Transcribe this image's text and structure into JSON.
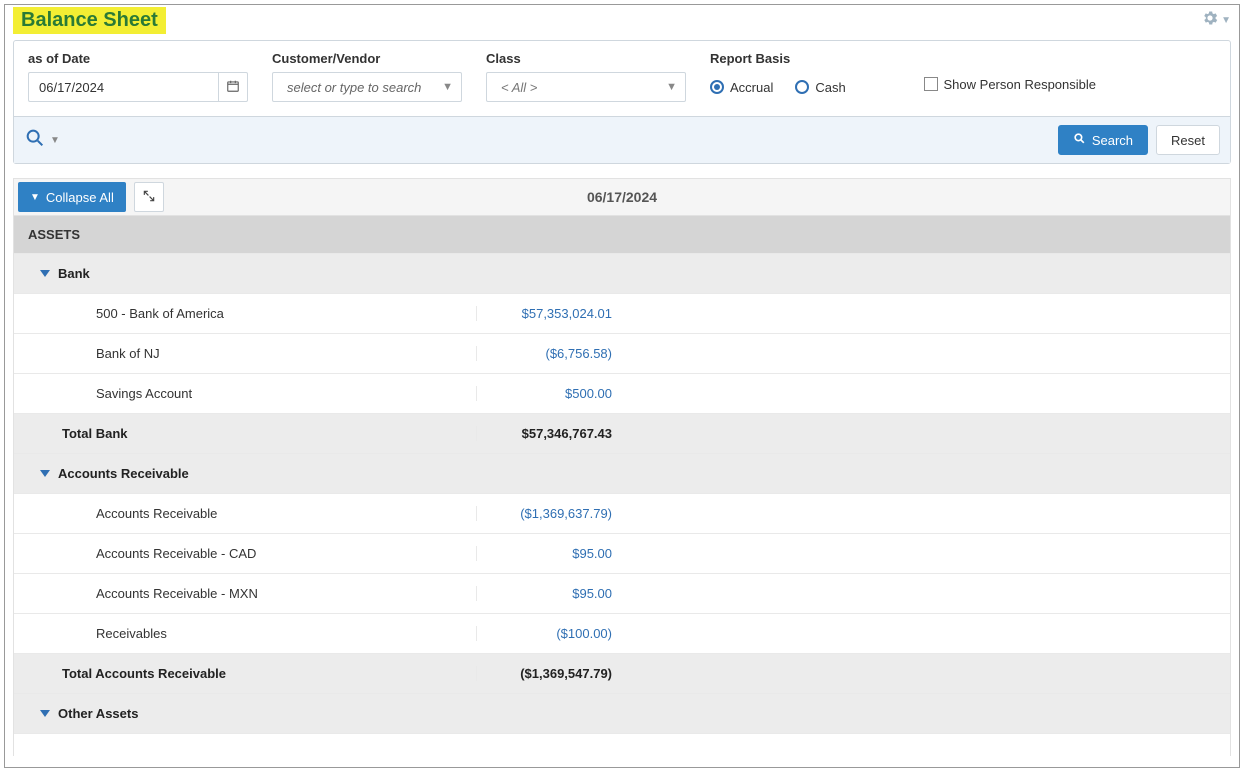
{
  "page": {
    "title": "Balance Sheet"
  },
  "filters": {
    "date_label": "as of Date",
    "date_value": "06/17/2024",
    "cv_label": "Customer/Vendor",
    "cv_placeholder": "select or type to search",
    "class_label": "Class",
    "class_value": "< All >",
    "basis_label": "Report Basis",
    "basis_accrual": "Accrual",
    "basis_cash": "Cash",
    "show_person_label": "Show Person Responsible"
  },
  "buttons": {
    "search": "Search",
    "reset": "Reset",
    "collapse_all": "Collapse All"
  },
  "toolbar": {
    "date": "06/17/2024"
  },
  "grid": {
    "assets_header": "ASSETS",
    "groups": [
      {
        "name": "Bank",
        "rows": [
          {
            "label": "500 - Bank of America",
            "value": "$57,353,024.01"
          },
          {
            "label": "Bank of NJ",
            "value": "($6,756.58)"
          },
          {
            "label": "Savings Account",
            "value": "$500.00"
          }
        ],
        "total_label": "Total Bank",
        "total_value": "$57,346,767.43"
      },
      {
        "name": "Accounts Receivable",
        "rows": [
          {
            "label": "Accounts Receivable",
            "value": "($1,369,637.79)"
          },
          {
            "label": "Accounts Receivable - CAD",
            "value": "$95.00"
          },
          {
            "label": "Accounts Receivable - MXN",
            "value": "$95.00"
          },
          {
            "label": "Receivables",
            "value": "($100.00)"
          }
        ],
        "total_label": "Total Accounts Receivable",
        "total_value": "($1,369,547.79)"
      },
      {
        "name": "Other Assets",
        "rows": [],
        "total_label": "",
        "total_value": ""
      }
    ]
  }
}
